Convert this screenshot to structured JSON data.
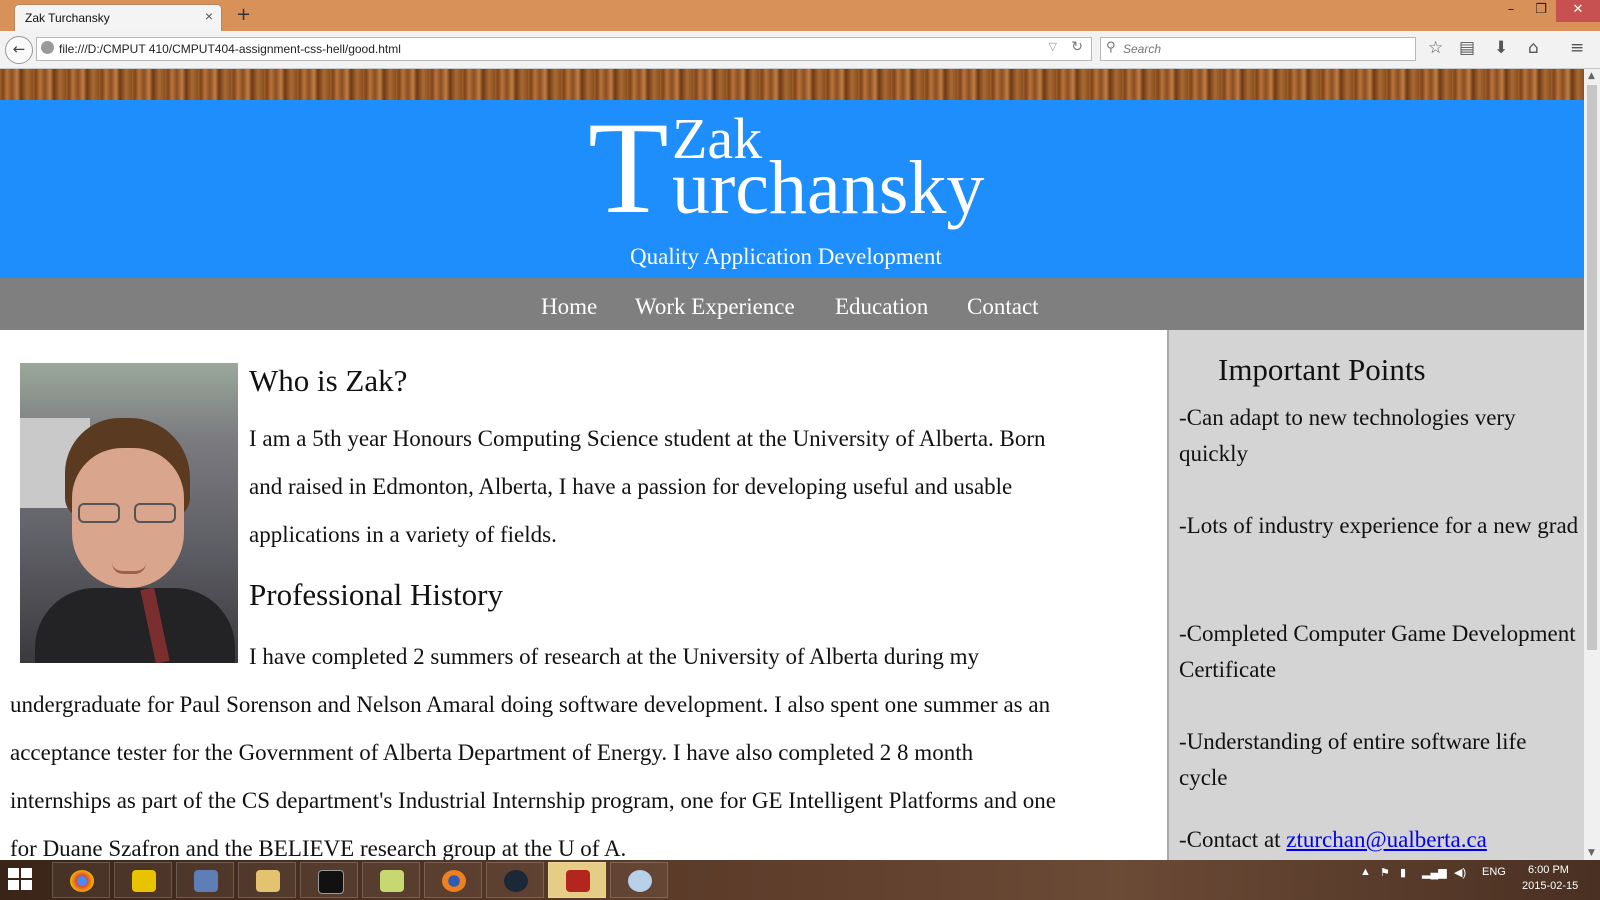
{
  "browser": {
    "tab_title": "Zak Turchansky",
    "tab_close": "×",
    "new_tab": "+",
    "url": "file:///D:/CMPUT 410/CMPUT404-assignment-css-hell/good.html",
    "search_placeholder": "Search",
    "icons": [
      "back-arrow-icon",
      "globe-icon",
      "url-dropdown-icon",
      "reload-icon",
      "search-icon",
      "bookmark-star-icon",
      "reading-list-icon",
      "download-icon",
      "home-icon",
      "menu-icon"
    ],
    "window_controls": {
      "minimize": "–",
      "maximize": "❐",
      "close": "✕"
    }
  },
  "header": {
    "logo_initial": "T",
    "logo_first": "Zak",
    "logo_last_rest": "urchansky",
    "tagline": "Quality Application Development",
    "background": "#1e8efc"
  },
  "nav": {
    "items": [
      "Home",
      "Work Experience",
      "Education",
      "Contact"
    ],
    "background": "#7f7f7f"
  },
  "main": {
    "who_heading": "Who is Zak?",
    "who_lines": [
      "I am a 5th year Honours Computing Science student at the University of Alberta. Born",
      "and raised in Edmonton, Alberta, I have a passion for developing useful and usable",
      "applications in a variety of fields."
    ],
    "history_heading": "Professional History",
    "history_lines": [
      "I have completed 2 summers of research at the University of Alberta during my",
      "undergraduate for Paul Sorenson and Nelson Amaral doing software development. I also spent one summer as an",
      "acceptance tester for the Government of Alberta Department of Energy. I have also completed 2 8 month",
      "internships as part of the CS department's Industrial Internship program, one for GE Intelligent Platforms and one",
      "for Duane Szafron and the BELIEVE research group at the U of A."
    ]
  },
  "sidebar": {
    "title": "Important Points",
    "points": [
      "-Can adapt to new technologies very quickly",
      "-Lots of industry experience for a new grad",
      "-Completed Computer Game Development Certificate",
      "-Understanding of entire software life cycle"
    ],
    "contact_prefix": "-Contact at ",
    "contact_email": "zturchan@ualberta.ca",
    "background": "#d4d4d4"
  },
  "taskbar": {
    "apps": [
      "chrome",
      "pdf",
      "network-tool",
      "file-explorer",
      "command-prompt",
      "editor",
      "firefox",
      "steam",
      "dota",
      "paint"
    ],
    "tray_language": "ENG",
    "clock_time": "6:00 PM",
    "clock_date": "2015-02-15"
  }
}
